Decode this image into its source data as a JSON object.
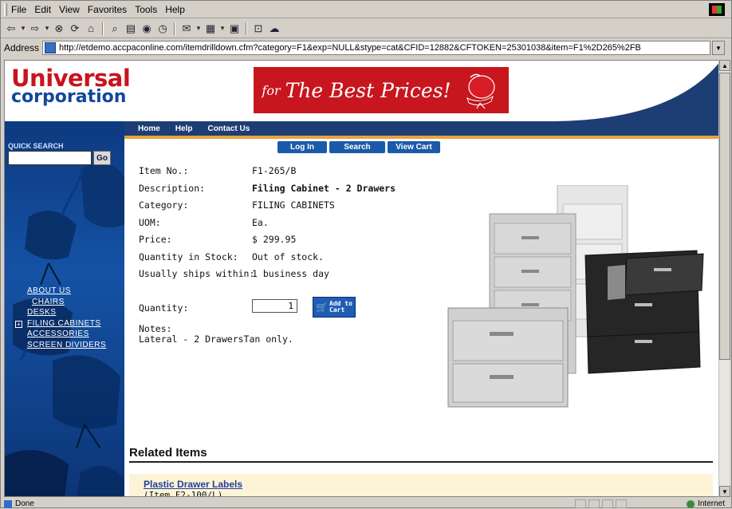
{
  "browser": {
    "menu": [
      "File",
      "Edit",
      "View",
      "Favorites",
      "Tools",
      "Help"
    ],
    "address_label": "Address",
    "url": "http://etdemo.accpaconline.com/itemdrilldown.cfm?category=F1&exp=NULL&stype=cat&CFID=12882&CFTOKEN=25301038&item=F1%2D265%2FB",
    "status_text": "Done",
    "zone_text": "Internet"
  },
  "header": {
    "brand_line1": "Universal",
    "brand_line2": "corporation",
    "banner_small": "for",
    "banner_big": "The Best Prices!",
    "nav": [
      "Home",
      "Help",
      "Contact Us"
    ],
    "accent_red": "#c8161e",
    "accent_navy": "#1d3d75",
    "accent_orange": "#e8a23b"
  },
  "sidebar": {
    "quick_search_label": "QUICK SEARCH",
    "go_label": "Go",
    "links": [
      "ABOUT US",
      "CHAIRS",
      "DESKS",
      "FILING CABINETS",
      "ACCESSORIES",
      "SCREEN DIVIDERS"
    ]
  },
  "actions": [
    "Log In",
    "Search",
    "View Cart"
  ],
  "item": {
    "fields": [
      {
        "label": "Item No.:",
        "value": "F1-265/B"
      },
      {
        "label": "Description:",
        "value": "Filing Cabinet - 2 Drawers"
      },
      {
        "label": "Category:",
        "value": "FILING CABINETS"
      },
      {
        "label": "UOM:",
        "value": "Ea."
      },
      {
        "label": "Price:",
        "value": "$ 299.95"
      },
      {
        "label": "Quantity in Stock:",
        "value": "Out of stock."
      },
      {
        "label": "Usually ships within:",
        "value": "1 business day"
      }
    ],
    "quantity_label": "Quantity:",
    "quantity_value": "1",
    "add_to_cart_line1": "Add to",
    "add_to_cart_line2": "Cart",
    "notes_label": "Notes:",
    "notes_text": "Lateral - 2 DrawersTan only."
  },
  "related": {
    "title": "Related Items",
    "items": [
      {
        "name": "Plastic Drawer Labels",
        "sub": "(Item F2-100/L)"
      }
    ]
  }
}
